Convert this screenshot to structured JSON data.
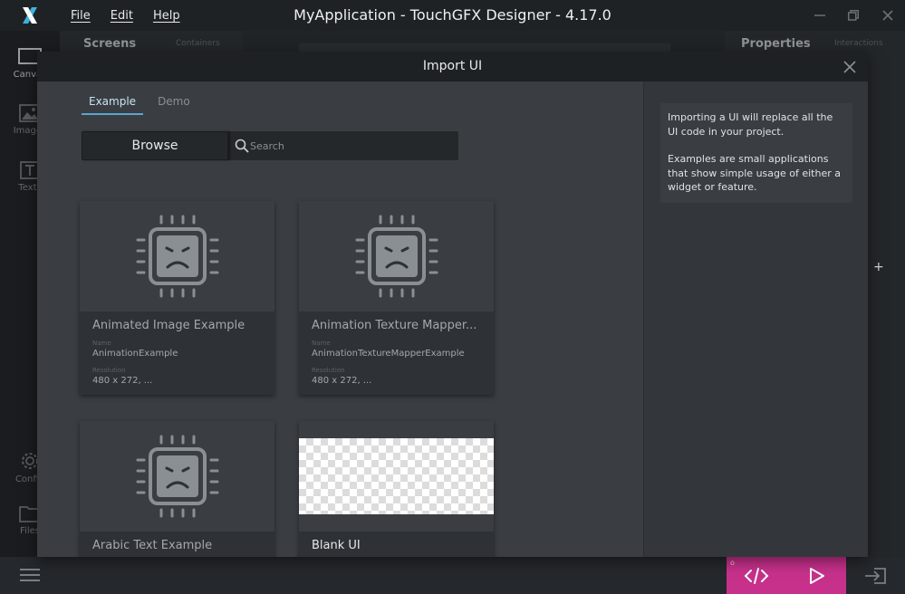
{
  "window": {
    "title": "MyApplication - TouchGFX Designer - 4.17.0",
    "menu": [
      "File",
      "Edit",
      "Help"
    ]
  },
  "sidebar": {
    "items": [
      {
        "label": "Canvas",
        "icon": "canvas-icon"
      },
      {
        "label": "Images",
        "icon": "image-icon"
      },
      {
        "label": "Texts",
        "icon": "text-icon"
      },
      {
        "label": "Config",
        "icon": "gear-icon"
      },
      {
        "label": "Files",
        "icon": "folder-icon"
      }
    ]
  },
  "background": {
    "screens_title": "Screens",
    "containers_tab": "Containers",
    "properties_title": "Properties",
    "interactions_tab": "Interactions",
    "add_symbol": "+"
  },
  "dialog": {
    "title": "Import UI",
    "tabs": [
      {
        "label": "Example",
        "active": true
      },
      {
        "label": "Demo",
        "active": false
      }
    ],
    "browse_label": "Browse",
    "search_placeholder": "Search",
    "cards": [
      {
        "title": "Animated Image Example",
        "name_label": "Name",
        "name": "AnimationExample",
        "res_label": "Resolution",
        "resolution": "480 x 272, ..."
      },
      {
        "title": "Animation Texture Mapper...",
        "name_label": "Name",
        "name": "AnimationTextureMapperExample",
        "res_label": "Resolution",
        "resolution": "480 x 272, ..."
      },
      {
        "title": "Arabic Text Example"
      },
      {
        "title": "Blank UI"
      }
    ],
    "info": {
      "p1": "Importing a UI will replace all the UI code in your project.",
      "p2": "Examples are small applications that show simple usage of either a widget or feature."
    }
  },
  "colors": {
    "accent": "#c7318c",
    "tab_underline": "#5aa6d2",
    "titlebar": "#1f2225"
  }
}
